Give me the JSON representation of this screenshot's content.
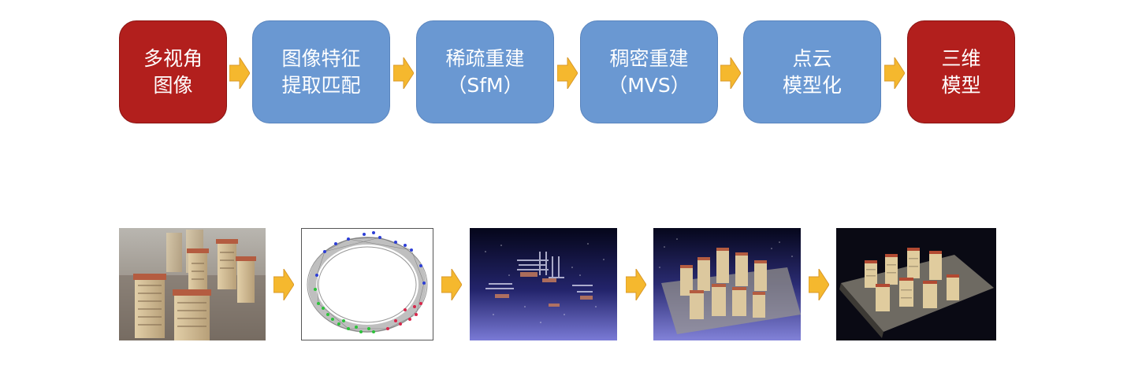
{
  "pipeline": {
    "steps": [
      {
        "line1": "多视角",
        "line2": "图像",
        "color": "#b21f1d"
      },
      {
        "line1": "图像特征",
        "line2": "提取匹配",
        "color": "#6a98d2"
      },
      {
        "line1": "稀疏重建",
        "line2": "（SfM）",
        "color": "#6a98d2"
      },
      {
        "line1": "稠密重建",
        "line2": "（MVS）",
        "color": "#6a98d2"
      },
      {
        "line1": "点云",
        "line2": "模型化",
        "color": "#6a98d2"
      },
      {
        "line1": "三维",
        "line2": "模型",
        "color": "#b21f1d"
      }
    ],
    "arrow_color": "#f5b82e"
  },
  "gallery": {
    "images": [
      {
        "icon": "aerial-photo-image"
      },
      {
        "icon": "feature-graph-image"
      },
      {
        "icon": "sparse-point-cloud-image"
      },
      {
        "icon": "dense-point-cloud-image"
      },
      {
        "icon": "textured-3d-model-image"
      }
    ]
  }
}
